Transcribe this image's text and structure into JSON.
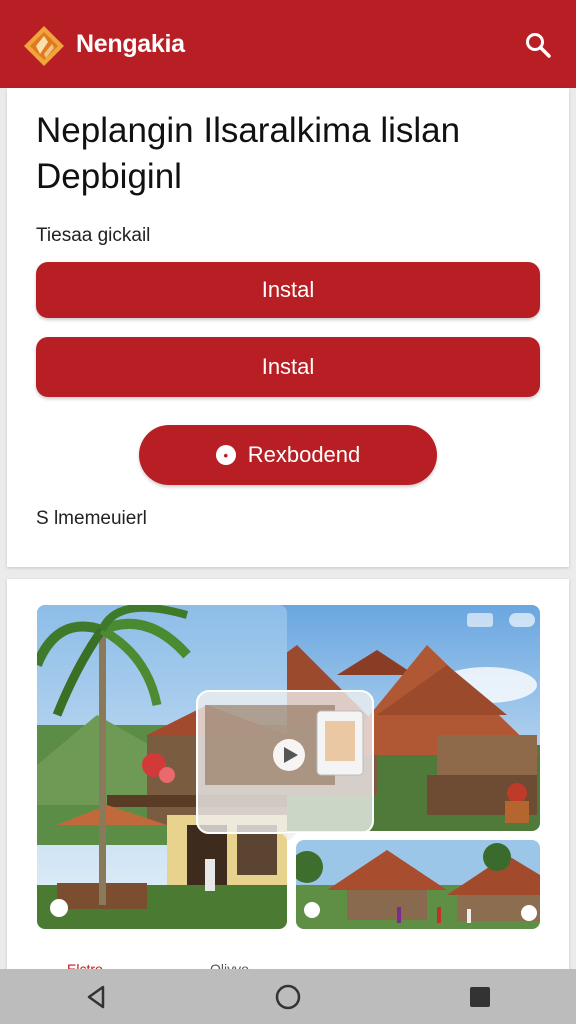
{
  "app": {
    "title": "Nengakia",
    "brand_color": "#b81f24",
    "logo_icon": "diamond-logo-icon",
    "search_icon": "search-icon"
  },
  "card": {
    "headline": "Neplangin Ilsaralkima lislan Depbiginl",
    "subtitle": "Tiesaa gickail",
    "install_button_1": "Instal",
    "install_button_2": "Instal",
    "pill_button": "Rexbodend",
    "pill_icon": "badge-icon",
    "footnote": "S lmemeuierl"
  },
  "media_card": {
    "main_image": "tropical-village-photo",
    "play_icon": "play-icon",
    "tabs": [
      "Elctro",
      "Oliyvo"
    ]
  },
  "system_nav": {
    "back_icon": "back-triangle-icon",
    "home_icon": "home-circle-icon",
    "recents_icon": "recents-square-icon"
  }
}
